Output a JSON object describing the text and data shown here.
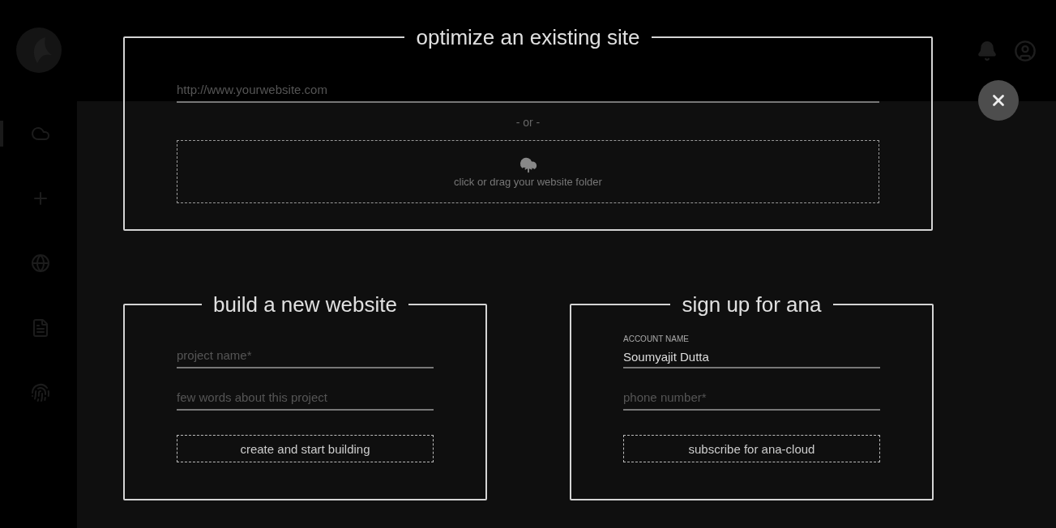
{
  "sidebar": {
    "items": [
      {
        "selected": true
      },
      {
        "selected": false
      },
      {
        "selected": false
      },
      {
        "selected": false
      },
      {
        "selected": false
      }
    ]
  },
  "modal": {
    "optimize": {
      "title": "optimize an existing site",
      "url_placeholder": "http://www.yourwebsite.com",
      "separator": "- or -",
      "dropzone": "click or drag your website folder"
    },
    "build": {
      "title": "build a new website",
      "fields": [
        {
          "placeholder": "project name*"
        },
        {
          "placeholder": "few words about this project"
        }
      ],
      "button": "create and start building"
    },
    "signup": {
      "title": "sign up for ana",
      "fields": [
        {
          "label": "ACCOUNT NAME",
          "value": "Soumyajit Dutta"
        },
        {
          "placeholder": "phone number*"
        }
      ],
      "button": "subscribe for ana-cloud"
    }
  }
}
